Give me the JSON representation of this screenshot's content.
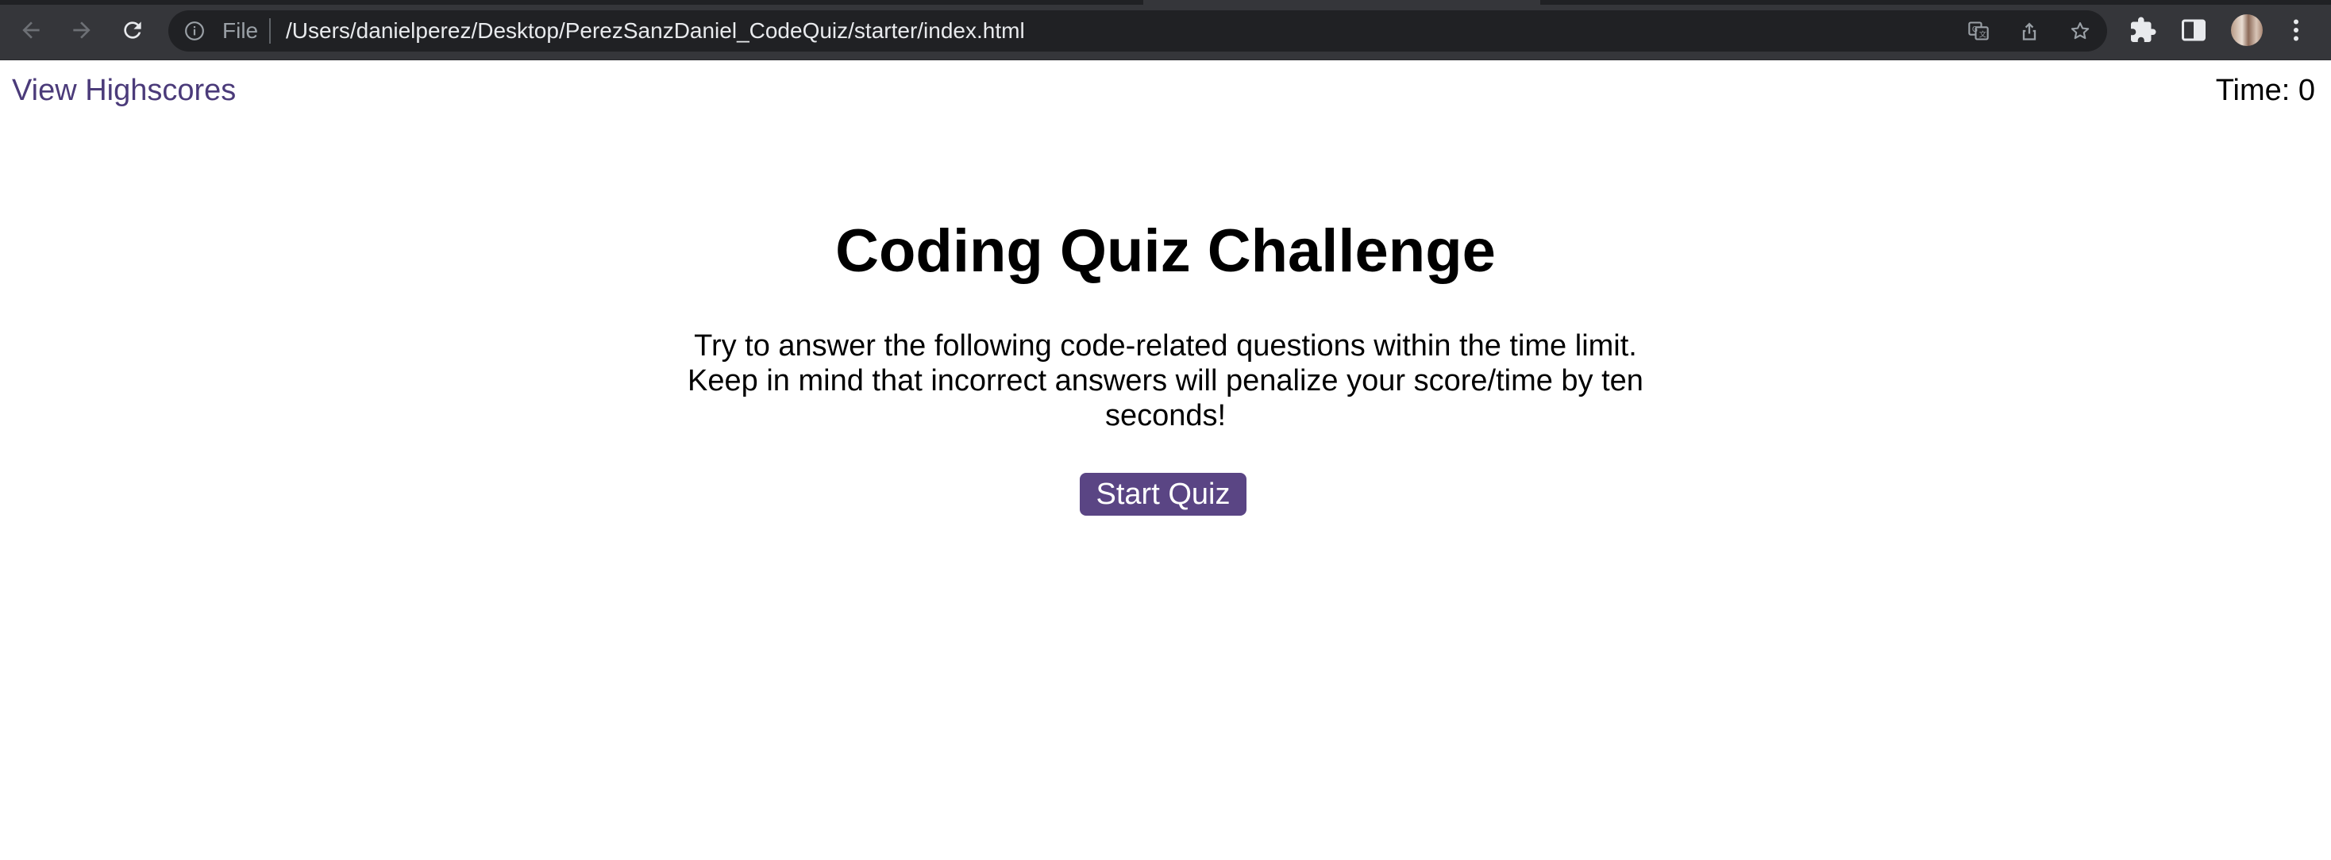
{
  "browser": {
    "address_bar": {
      "scheme_label": "File",
      "url": "/Users/danielperez/Desktop/PerezSanzDaniel_CodeQuiz/starter/index.html"
    },
    "icons": {
      "back": "back-arrow-icon",
      "forward": "forward-arrow-icon",
      "reload": "reload-icon",
      "site_info": "info-icon",
      "translate": "translate-icon",
      "share": "share-icon",
      "bookmark": "star-icon",
      "extensions": "puzzle-icon",
      "side_panel": "side-panel-icon",
      "menu": "kebab-menu-icon"
    }
  },
  "page": {
    "highscores_link": "View Highscores",
    "timer": {
      "label": "Time: ",
      "value": "0"
    },
    "title": "Coding Quiz Challenge",
    "intro": "Try to answer the following code-related questions within the time limit. Keep in mind that incorrect answers will penalize your score/time by ten seconds!",
    "start_button": "Start Quiz"
  },
  "colors": {
    "link": "#4b3b7a",
    "button_bg": "#5a4584",
    "button_text": "#ffffff",
    "chrome_bg": "#35363a",
    "omnibox_bg": "#202124"
  }
}
